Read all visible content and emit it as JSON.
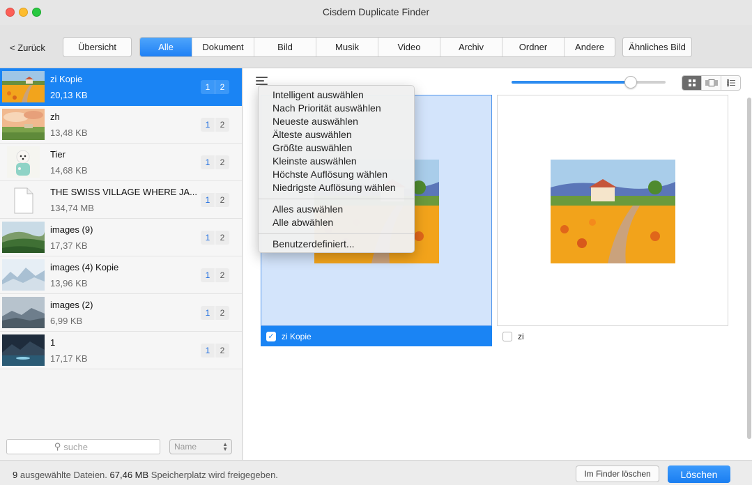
{
  "window": {
    "title": "Cisdem Duplicate Finder"
  },
  "toolbar": {
    "back_label": "< Zurück",
    "overview_label": "Übersicht",
    "tabs": [
      "Alle",
      "Dokument",
      "Bild",
      "Musik",
      "Video",
      "Archiv",
      "Ordner",
      "Andere"
    ],
    "similar_label": "Ähnliches Bild"
  },
  "sidebar": {
    "items": [
      {
        "name": "zi Kopie",
        "size": "20,13 KB",
        "b1": "1",
        "b2": "2",
        "thumb": "landscape-flowers-icon"
      },
      {
        "name": "zh",
        "size": "13,48 KB",
        "b1": "1",
        "b2": "2",
        "thumb": "landscape-sky-icon"
      },
      {
        "name": "Tier",
        "size": "14,68 KB",
        "b1": "1",
        "b2": "2",
        "thumb": "dog-icon"
      },
      {
        "name": "THE SWISS VILLAGE WHERE JA...",
        "size": "134,74 MB",
        "b1": "1",
        "b2": "2",
        "thumb": "document-icon"
      },
      {
        "name": "images (9)",
        "size": "17,37 KB",
        "b1": "1",
        "b2": "2",
        "thumb": "hills-icon"
      },
      {
        "name": "images (4) Kopie",
        "size": "13,96 KB",
        "b1": "1",
        "b2": "2",
        "thumb": "misty-mountains-icon"
      },
      {
        "name": "images (2)",
        "size": "6,99 KB",
        "b1": "1",
        "b2": "2",
        "thumb": "mountains-icon"
      },
      {
        "name": "1",
        "size": "17,17 KB",
        "b1": "1",
        "b2": "2",
        "thumb": "night-lake-icon"
      }
    ],
    "search_placeholder": "suche",
    "sort_value": "Name"
  },
  "menu": {
    "items": [
      "Intelligent auswählen",
      "Nach Priorität auswählen",
      "Neueste auswählen",
      "Älteste auswählen",
      "Größte auswählen",
      "Kleinste auswählen",
      "Höchste Auflösung wählen",
      "Niedrigste Auflösung wählen"
    ],
    "items2": [
      "Alles auswählen",
      "Alle abwählen"
    ],
    "custom": "Benutzerdefiniert..."
  },
  "cards": [
    {
      "name": "zi Kopie",
      "checked": true
    },
    {
      "name": "zi",
      "checked": false
    }
  ],
  "status": {
    "count": "9",
    "selected_text": "ausgewählte Dateien.",
    "space": "67,46 MB",
    "space_text": "Speicherplatz wird freigegeben.",
    "finder_label": "Im Finder löschen",
    "delete_label": "Löschen"
  },
  "colors": {
    "accent": "#1a84f4",
    "selected_card": "#d3e4fb"
  }
}
